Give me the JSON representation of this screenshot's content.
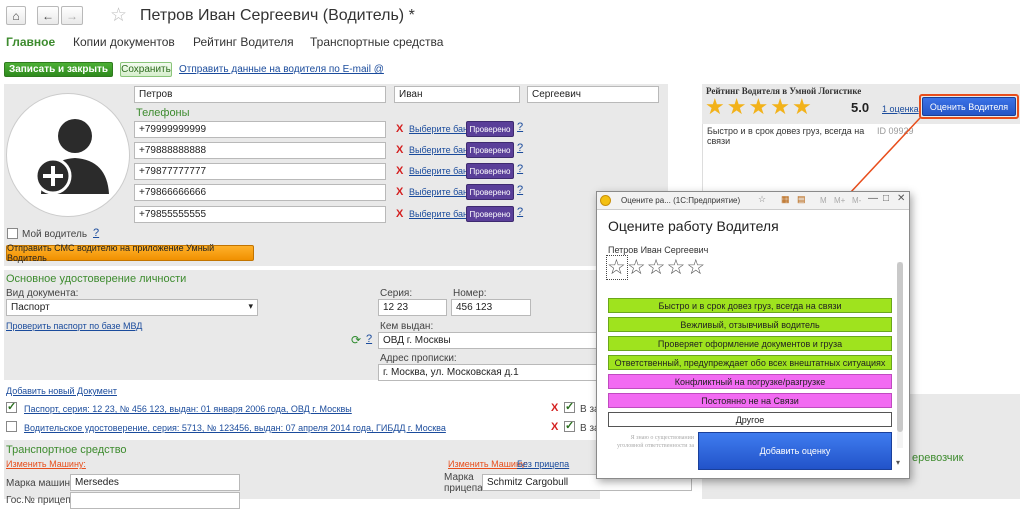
{
  "window": {
    "title": "Петров Иван Сергеевич (Водитель) *"
  },
  "tabs": [
    {
      "label": "Главное"
    },
    {
      "label": "Копии документов"
    },
    {
      "label": "Рейтинг Водителя"
    },
    {
      "label": "Транспортные средства"
    }
  ],
  "toolbar": {
    "save_close": "Записать и закрыть",
    "save": "Сохранить",
    "send_email": "Отправить данные на водителя по E-mail @"
  },
  "person": {
    "last_name": "Петров",
    "first_name": "Иван",
    "middle_name": "Сергеевич"
  },
  "phones": {
    "header": "Телефоны",
    "items": [
      "+79999999999",
      "+79888888888",
      "+79877777777",
      "+79866666666",
      "+79855555555"
    ],
    "choose_bank": "Выберите банк",
    "checked": "Проверено",
    "help": "?",
    "remove": "X"
  },
  "my_driver": {
    "label": "Мой водитель",
    "help": "?"
  },
  "sms_button": "Отправить СМС водителю на приложение Умный Водитель",
  "id_doc": {
    "header": "Основное удостоверение личности",
    "doc_type_label": "Вид документа:",
    "doc_type_value": "Паспорт",
    "series_label": "Серия:",
    "series_value": "12 23",
    "number_label": "Номер:",
    "number_value": "456 123",
    "issued_label": "Кем выдан:",
    "issued_value": "ОВД г. Москвы",
    "address_label": "Адрес прописки:",
    "address_value": "г. Москва, ул. Московская д.1",
    "verify_link": "Проверить паспорт по базе МВД",
    "help": "?"
  },
  "documents": {
    "add_link": "Добавить новый Документ",
    "items": [
      {
        "text": "Паспорт, серия: 12 23, № 456 123, выдан: 01 января 2006 года, ОВД г. Москвы",
        "right": "В за"
      },
      {
        "text": "Водительское удостоверение, серия: 5713, № 123456, выдан: 07 апреля 2014 года, ГИБДД г. Москва",
        "right": "В за"
      }
    ],
    "remove": "X"
  },
  "vehicle": {
    "header": "Транспортное средство",
    "change_car": "Изменить Машину:",
    "car_brand_label": "Марка машины:",
    "car_brand_value": "Mersedes",
    "change_trailer": "Изменить Машину:",
    "no_trailer": "Без прицепа",
    "trailer_label": "Марка прицепа:",
    "trailer_value": "Schmitz Cargobull",
    "truncated_label": "Гос.№ прицепа",
    "carrier": "еревозчик"
  },
  "rating_panel": {
    "title": "Рейтинг Водителя в Умной Логистике",
    "score": "5.0",
    "count_link": "1 оценка",
    "rate_button": "Оценить Водителя",
    "stars": 5,
    "review_text": "Быстро и в срок довез груз, всегда на связи",
    "review_id": "ID 09929"
  },
  "dialog": {
    "window_title": "Оцените ра... (1С:Предприятие)",
    "toolbar": [
      "M",
      "M+",
      "M-"
    ],
    "heading": "Оцените работу Водителя",
    "driver_name": "Петров Иван Сергеевич",
    "stars_selected": 0,
    "options": [
      {
        "label": "Быстро и в срок довез груз, всегда на связи",
        "color": "#9fe31e"
      },
      {
        "label": "Вежливый, отзывчивый водитель",
        "color": "#9fe31e"
      },
      {
        "label": "Проверяет оформление документов и груза",
        "color": "#9fe31e"
      },
      {
        "label": "Ответственный, предупреждает обо всех внештатных ситуациях",
        "color": "#9fe31e"
      },
      {
        "label": "Конфликтный на погрузке/разгрузке",
        "color": "#f26bf2"
      },
      {
        "label": "Постоянно не на Связи",
        "color": "#f26bf2"
      },
      {
        "label": "Другое",
        "color": "#ffffff"
      }
    ],
    "comment_placeholder": "Я знаю о существовании уголовной ответственности за",
    "submit": "Добавить оценку"
  },
  "colors": {
    "accent_green": "#3d8b2e",
    "accent_blue": "#2f62d7",
    "highlight": "#e84e1c"
  }
}
